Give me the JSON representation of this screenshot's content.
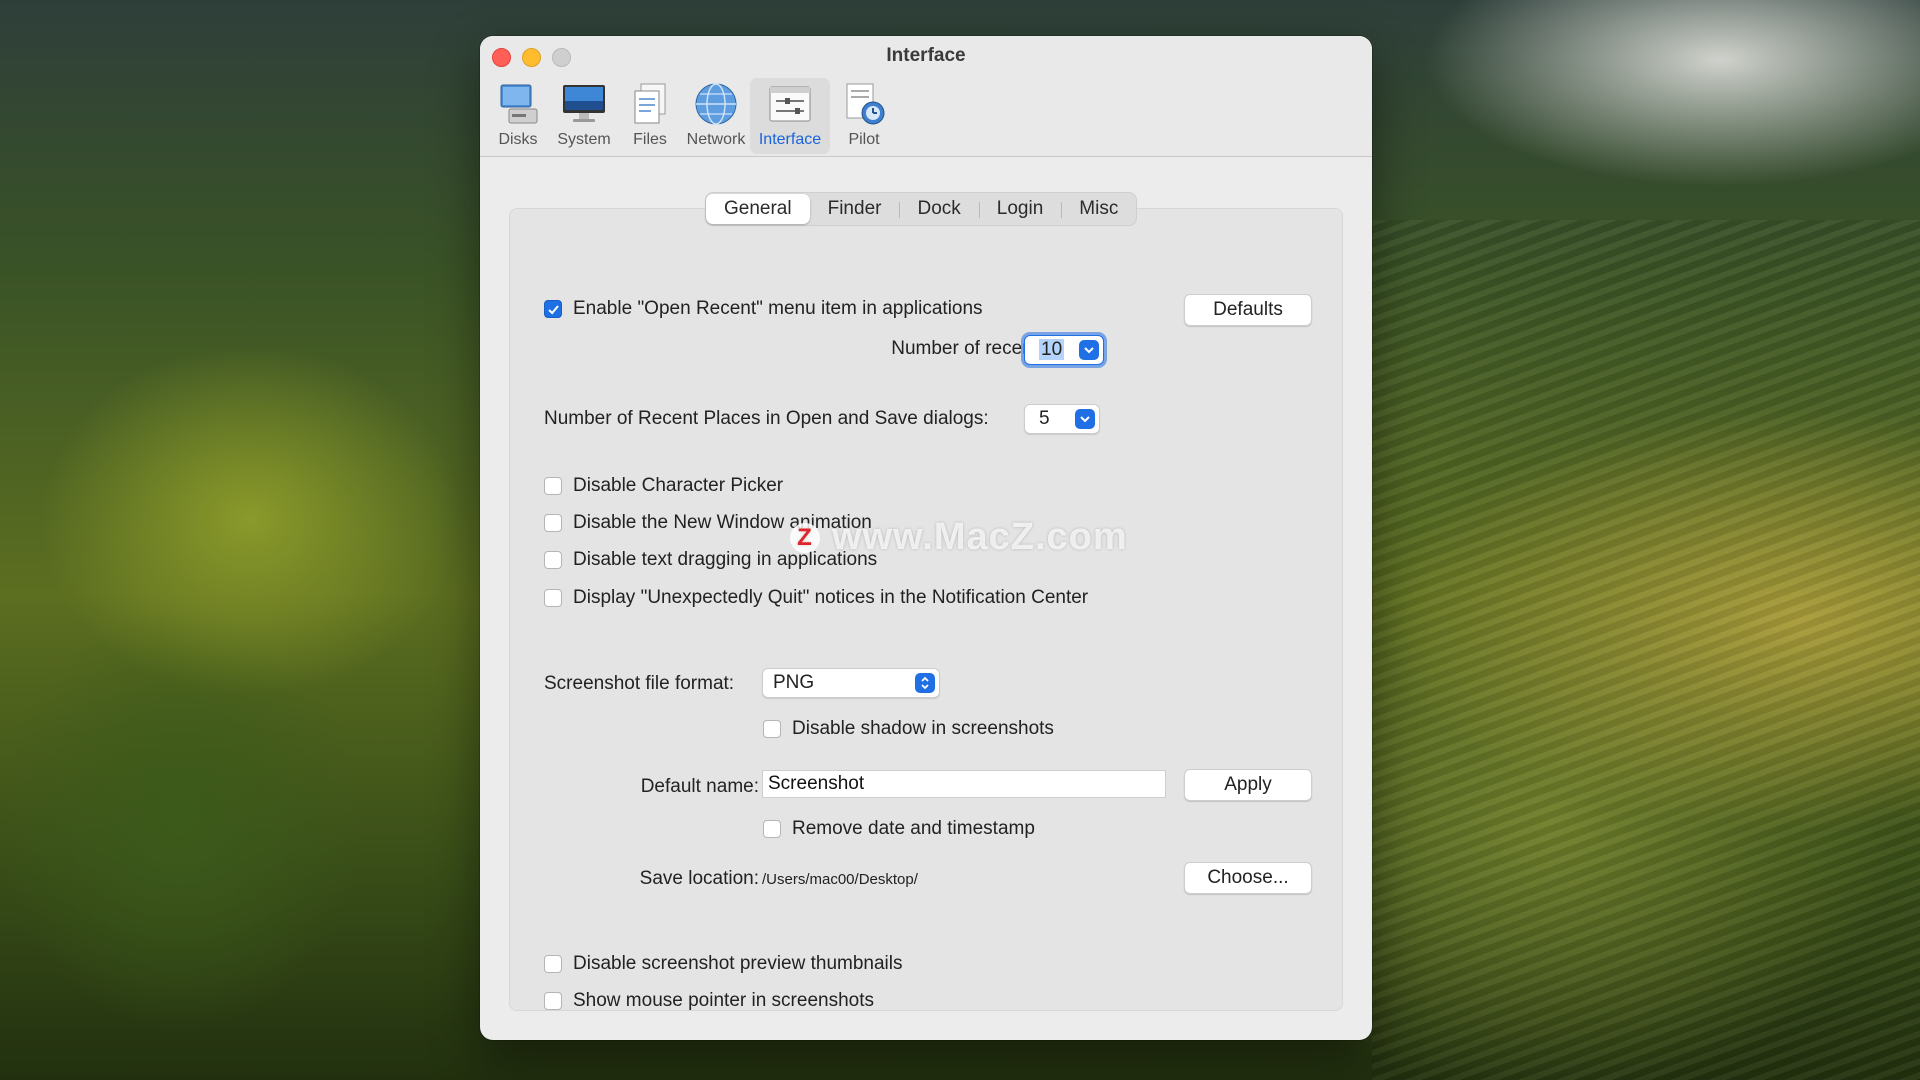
{
  "window": {
    "title": "Interface"
  },
  "toolbar": {
    "items": [
      {
        "label": "Disks",
        "icon": "disks-icon"
      },
      {
        "label": "System",
        "icon": "system-icon"
      },
      {
        "label": "Files",
        "icon": "files-icon"
      },
      {
        "label": "Network",
        "icon": "network-icon"
      },
      {
        "label": "Interface",
        "icon": "interface-icon",
        "active": true
      },
      {
        "label": "Pilot",
        "icon": "pilot-icon"
      }
    ]
  },
  "tabs": [
    {
      "label": "General",
      "active": true
    },
    {
      "label": "Finder"
    },
    {
      "label": "Dock"
    },
    {
      "label": "Login"
    },
    {
      "label": "Misc"
    }
  ],
  "general": {
    "open_recent": {
      "label": "Enable \"Open Recent\" menu item in applications",
      "checked": true
    },
    "defaults_button": "Defaults",
    "recent_items_label": "Number of recent items:",
    "recent_items_value": "10",
    "recent_places_label": "Number of Recent Places in Open and Save dialogs:",
    "recent_places_value": "5",
    "options": [
      {
        "label": "Disable Character Picker",
        "checked": false
      },
      {
        "label": "Disable the New Window animation",
        "checked": false
      },
      {
        "label": "Disable text dragging in applications",
        "checked": false
      },
      {
        "label": "Display \"Unexpectedly Quit\" notices in the Notification Center",
        "checked": false
      }
    ],
    "screenshot_format_label": "Screenshot file format:",
    "screenshot_format_value": "PNG",
    "disable_shadow": {
      "label": "Disable shadow in screenshots",
      "checked": false
    },
    "default_name_label": "Default name:",
    "default_name_value": "Screenshot",
    "apply_button": "Apply",
    "remove_date": {
      "label": "Remove date and timestamp",
      "checked": false
    },
    "save_location_label": "Save location:",
    "save_location_value": "/Users/mac00/Desktop/",
    "choose_button": "Choose...",
    "bottom_options": [
      {
        "label": "Disable screenshot preview thumbnails",
        "checked": false
      },
      {
        "label": "Show mouse pointer in screenshots",
        "checked": false
      }
    ]
  },
  "watermark": {
    "logo": "Z",
    "text": "www.MacZ.com"
  },
  "colors": {
    "accent": "#1f6fe5",
    "active_tab_text": "#1a64d8"
  }
}
